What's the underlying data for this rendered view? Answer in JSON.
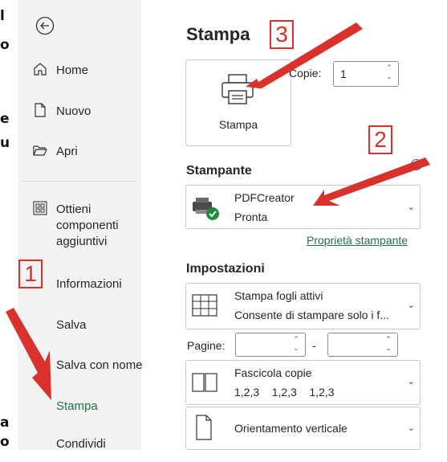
{
  "doc_edge_chars": [
    "l",
    "o",
    "e",
    "u",
    "a",
    "o"
  ],
  "sidebar": {
    "items": [
      {
        "label": "Home",
        "icon": "home-icon"
      },
      {
        "label": "Nuovo",
        "icon": "new-document-icon"
      },
      {
        "label": "Apri",
        "icon": "open-folder-icon"
      },
      {
        "label": "Ottieni\ncomponenti\naggiuntivi",
        "icon": "add-ins-icon"
      },
      {
        "label": "Informazioni"
      },
      {
        "label": "Salva"
      },
      {
        "label": "Salva con nome"
      },
      {
        "label": "Stampa",
        "active": true
      },
      {
        "label": "Condividi"
      }
    ]
  },
  "main": {
    "title": "Stampa",
    "print_button_label": "Stampa",
    "copies_label": "Copie:",
    "copies_value": "1",
    "printer_section": "Stampante",
    "printer_name": "PDFCreator",
    "printer_status": "Pronta",
    "printer_properties_link": "Proprietà stampante",
    "settings_section": "Impostazioni",
    "setting_sheets_title": "Stampa fogli attivi",
    "setting_sheets_desc": "Consente di stampare solo i f...",
    "pages_label": "Pagine:",
    "pages_from": "",
    "pages_dash": "-",
    "pages_to": "",
    "collate_title": "Fascicola copie",
    "collate_desc": "1,2,3    1,2,3    1,2,3",
    "orientation_title": "Orientamento verticale"
  },
  "annotations": {
    "badge1": "1",
    "badge2": "2",
    "badge3": "3",
    "color": "#d9312b"
  },
  "colors": {
    "accent": "#217346",
    "sidebar_bg": "#f3f3f3"
  }
}
